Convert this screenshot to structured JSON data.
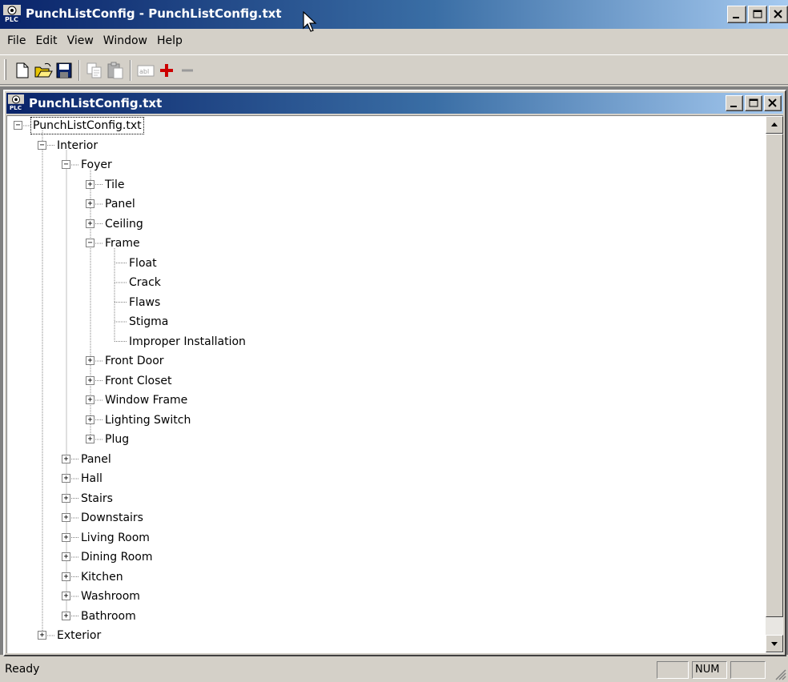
{
  "window": {
    "title": "PunchListConfig - PunchListConfig.txt",
    "icon_name": "plc-app-icon"
  },
  "menu": [
    "File",
    "Edit",
    "View",
    "Window",
    "Help"
  ],
  "toolbar": {
    "buttons": [
      "new-file-icon",
      "open-folder-icon",
      "save-icon",
      "copy-icon",
      "paste-icon",
      "properties-icon",
      "add-icon",
      "remove-icon"
    ]
  },
  "child_window": {
    "title": "PunchListConfig.txt"
  },
  "tree": [
    {
      "label": "PunchListConfig.txt",
      "level": 0,
      "expander": "minus",
      "selected": true
    },
    {
      "label": "Interior",
      "level": 1,
      "expander": "minus"
    },
    {
      "label": "Foyer",
      "level": 2,
      "expander": "minus"
    },
    {
      "label": "Tile",
      "level": 3,
      "expander": "plus"
    },
    {
      "label": "Panel",
      "level": 3,
      "expander": "plus"
    },
    {
      "label": "Ceiling",
      "level": 3,
      "expander": "plus"
    },
    {
      "label": "Frame",
      "level": 3,
      "expander": "minus"
    },
    {
      "label": "Float",
      "level": 4,
      "expander": "none"
    },
    {
      "label": "Crack",
      "level": 4,
      "expander": "none"
    },
    {
      "label": "Flaws",
      "level": 4,
      "expander": "none"
    },
    {
      "label": "Stigma",
      "level": 4,
      "expander": "none"
    },
    {
      "label": "Improper Installation",
      "level": 4,
      "expander": "none"
    },
    {
      "label": "Front Door",
      "level": 3,
      "expander": "plus"
    },
    {
      "label": "Front Closet",
      "level": 3,
      "expander": "plus"
    },
    {
      "label": "Window Frame",
      "level": 3,
      "expander": "plus"
    },
    {
      "label": "Lighting Switch",
      "level": 3,
      "expander": "plus"
    },
    {
      "label": "Plug",
      "level": 3,
      "expander": "plus"
    },
    {
      "label": "Panel",
      "level": 2,
      "expander": "plus"
    },
    {
      "label": "Hall",
      "level": 2,
      "expander": "plus"
    },
    {
      "label": "Stairs",
      "level": 2,
      "expander": "plus"
    },
    {
      "label": "Downstairs",
      "level": 2,
      "expander": "plus"
    },
    {
      "label": "Living Room",
      "level": 2,
      "expander": "plus"
    },
    {
      "label": "Dining Room",
      "level": 2,
      "expander": "plus"
    },
    {
      "label": "Kitchen",
      "level": 2,
      "expander": "plus"
    },
    {
      "label": "Washroom",
      "level": 2,
      "expander": "plus"
    },
    {
      "label": "Bathroom",
      "level": 2,
      "expander": "plus"
    },
    {
      "label": "Exterior",
      "level": 1,
      "expander": "plus"
    }
  ],
  "statusbar": {
    "text": "Ready",
    "num": "NUM"
  },
  "colors": {
    "title_gradient_start": "#0a246a",
    "title_gradient_end": "#a6caf0",
    "face": "#d4d0c8",
    "add_icon": "#cc0000"
  }
}
